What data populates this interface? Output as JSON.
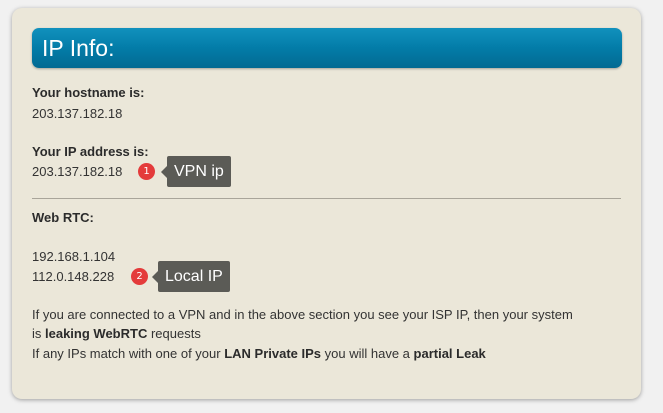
{
  "header": {
    "title": "IP Info:"
  },
  "hostname": {
    "label": "Your hostname is:",
    "value": "203.137.182.18"
  },
  "ip_address": {
    "label": "Your IP address is:",
    "value": "203.137.182.18"
  },
  "vpn_callout": {
    "number": "1",
    "text": "VPN ip"
  },
  "webrtc": {
    "label": "Web RTC:",
    "ips": [
      "192.168.1.104",
      "112.0.148.228"
    ]
  },
  "local_callout": {
    "number": "2",
    "text": "Local IP"
  },
  "notes": {
    "line1": "If you are connected to a VPN and in the above section you see your ISP IP, then your system",
    "line2_pre": "is ",
    "line2_bold": "leaking WebRTC",
    "line2_post": " requests",
    "line3_pre": "If any IPs match with one of your ",
    "line3_bold1": "LAN Private IPs",
    "line3_mid": " you will have a ",
    "line3_bold2": "partial Leak"
  },
  "colors": {
    "card_bg": "#ebe7d9",
    "header_blue": "#037ca8",
    "badge_red": "#e43b3b",
    "callout_gray": "#5b5b56"
  }
}
